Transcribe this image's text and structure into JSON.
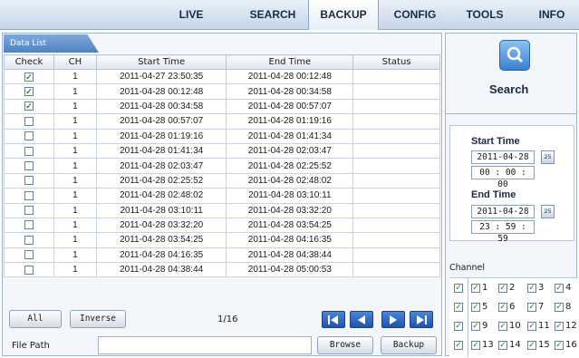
{
  "nav": {
    "tabs": [
      {
        "label": "LIVE",
        "active": false
      },
      {
        "label": "SEARCH",
        "active": false
      },
      {
        "label": "BACKUP",
        "active": true
      },
      {
        "label": "CONFIG",
        "active": false
      },
      {
        "label": "TOOLS",
        "active": false
      },
      {
        "label": "INFO",
        "active": false
      }
    ]
  },
  "data_list": {
    "tab_label": "Data List",
    "columns": [
      "Check",
      "CH",
      "Start Time",
      "End Time",
      "Status"
    ],
    "rows": [
      {
        "checked": true,
        "ch": "1",
        "start": "2011-04-27 23:50:35",
        "end": "2011-04-28 00:12:48",
        "status": ""
      },
      {
        "checked": true,
        "ch": "1",
        "start": "2011-04-28 00:12:48",
        "end": "2011-04-28 00:34:58",
        "status": ""
      },
      {
        "checked": true,
        "ch": "1",
        "start": "2011-04-28 00:34:58",
        "end": "2011-04-28 00:57:07",
        "status": ""
      },
      {
        "checked": false,
        "ch": "1",
        "start": "2011-04-28 00:57:07",
        "end": "2011-04-28 01:19:16",
        "status": ""
      },
      {
        "checked": false,
        "ch": "1",
        "start": "2011-04-28 01:19:16",
        "end": "2011-04-28 01:41:34",
        "status": ""
      },
      {
        "checked": false,
        "ch": "1",
        "start": "2011-04-28 01:41:34",
        "end": "2011-04-28 02:03:47",
        "status": ""
      },
      {
        "checked": false,
        "ch": "1",
        "start": "2011-04-28 02:03:47",
        "end": "2011-04-28 02:25:52",
        "status": ""
      },
      {
        "checked": false,
        "ch": "1",
        "start": "2011-04-28 02:25:52",
        "end": "2011-04-28 02:48:02",
        "status": ""
      },
      {
        "checked": false,
        "ch": "1",
        "start": "2011-04-28 02:48:02",
        "end": "2011-04-28 03:10:11",
        "status": ""
      },
      {
        "checked": false,
        "ch": "1",
        "start": "2011-04-28 03:10:11",
        "end": "2011-04-28 03:32:20",
        "status": ""
      },
      {
        "checked": false,
        "ch": "1",
        "start": "2011-04-28 03:32:20",
        "end": "2011-04-28 03:54:25",
        "status": ""
      },
      {
        "checked": false,
        "ch": "1",
        "start": "2011-04-28 03:54:25",
        "end": "2011-04-28 04:16:35",
        "status": ""
      },
      {
        "checked": false,
        "ch": "1",
        "start": "2011-04-28 04:16:35",
        "end": "2011-04-28 04:38:44",
        "status": ""
      },
      {
        "checked": false,
        "ch": "1",
        "start": "2011-04-28 04:38:44",
        "end": "2011-04-28 05:00:53",
        "status": ""
      }
    ]
  },
  "controls": {
    "all_label": "All",
    "inverse_label": "Inverse",
    "page_info": "1/16",
    "file_path_label": "File Path",
    "file_path_value": "",
    "browse_label": "Browse",
    "backup_label": "Backup",
    "pager_icons": [
      "first-page-icon",
      "prev-page-icon",
      "next-page-icon",
      "last-page-icon"
    ]
  },
  "search": {
    "label": "Search",
    "start_time_label": "Start Time",
    "start_date": "2011-04-28",
    "start_time": "00 : 00 : 00",
    "end_time_label": "End Time",
    "end_date": "2011-04-28",
    "end_time": "23 : 59 : 59",
    "calendar_label": "25"
  },
  "channels": {
    "label": "Channel",
    "rows": [
      {
        "all_checked": true,
        "items": [
          {
            "label": "1",
            "checked": true
          },
          {
            "label": "2",
            "checked": true
          },
          {
            "label": "3",
            "checked": true
          },
          {
            "label": "4",
            "checked": true
          }
        ]
      },
      {
        "all_checked": true,
        "items": [
          {
            "label": "5",
            "checked": true
          },
          {
            "label": "6",
            "checked": true
          },
          {
            "label": "7",
            "checked": true
          },
          {
            "label": "8",
            "checked": true
          }
        ]
      },
      {
        "all_checked": true,
        "items": [
          {
            "label": "9",
            "checked": true
          },
          {
            "label": "10",
            "checked": true
          },
          {
            "label": "11",
            "checked": true
          },
          {
            "label": "12",
            "checked": true
          }
        ]
      },
      {
        "all_checked": true,
        "items": [
          {
            "label": "13",
            "checked": true
          },
          {
            "label": "14",
            "checked": true
          },
          {
            "label": "15",
            "checked": true
          },
          {
            "label": "16",
            "checked": true
          }
        ]
      }
    ]
  },
  "colors": {
    "nav_bg": "#c6d6ea",
    "accent_blue": "#2f6bc0",
    "check_green": "#1d8a1d"
  }
}
